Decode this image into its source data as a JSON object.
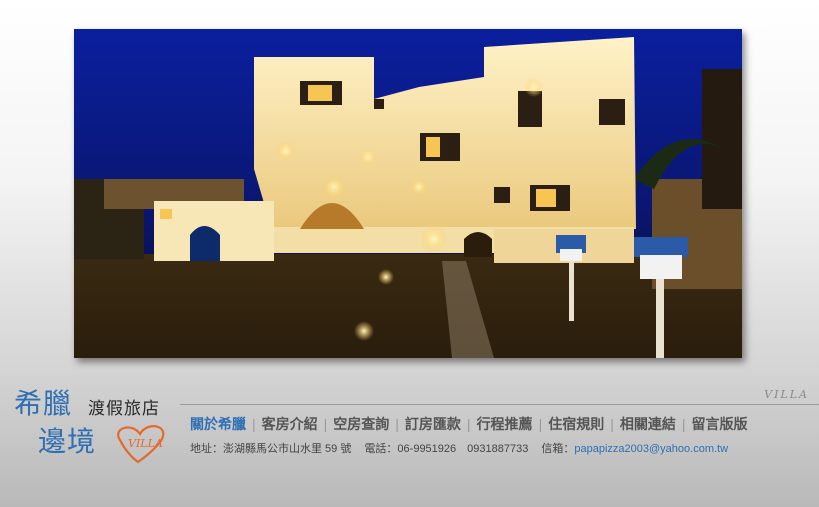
{
  "hero": {
    "alt": "villa night photo"
  },
  "logo": {
    "name_top": "希臘",
    "subtitle": "渡假旅店",
    "name_bottom": "邊境",
    "badge": "VILLA"
  },
  "tag": "VILLA",
  "nav": {
    "items": [
      {
        "label": "關於希臘",
        "active": true
      },
      {
        "label": "客房介紹"
      },
      {
        "label": "空房查詢"
      },
      {
        "label": "訂房匯款"
      },
      {
        "label": "行程推薦"
      },
      {
        "label": "住宿規則"
      },
      {
        "label": "相關連結"
      },
      {
        "label": "留言版版"
      }
    ]
  },
  "info": {
    "address": "地址：澎湖縣馬公市山水里 59 號",
    "phone": "電話：06-9951926　0931887733",
    "email_label": "信箱：",
    "email": "papapizza2003@yahoo.com.tw"
  },
  "colors": {
    "accent": "#2f6fb3",
    "sky": "#0a1a8c"
  }
}
